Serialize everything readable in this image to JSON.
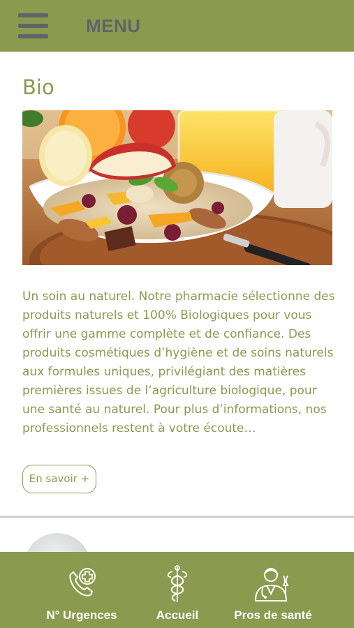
{
  "header": {
    "menu_label": "MENU",
    "menu_icon": "hamburger-menu-icon"
  },
  "section": {
    "title": "Bio",
    "image_alt": "bowl of muesli with fruit, nuts and orange juice",
    "description": "Un soin au naturel. Notre pharmacie sélectionne des produits naturels et 100% Biologiques pour vous offrir une gamme complète et de confiance. Des produits cosmétiques d’hygiène et de soins naturels aux formules uniques, privilégiant des matières premières issues de l’agriculture biologique, pour une santé au naturel. Pour plus d’informations, nos professionnels restent à votre écoute…",
    "more_button": "En savoir +"
  },
  "bottom_nav": {
    "items": [
      {
        "label": "N° Urgences",
        "icon": "phone-medical-cross-icon"
      },
      {
        "label": "Accueil",
        "icon": "caduceus-icon"
      },
      {
        "label": "Pros de santé",
        "icon": "doctor-icon"
      }
    ]
  },
  "colors": {
    "brand_green": "#8a9a4e",
    "header_text": "#5f6468",
    "background": "#ffffff"
  }
}
